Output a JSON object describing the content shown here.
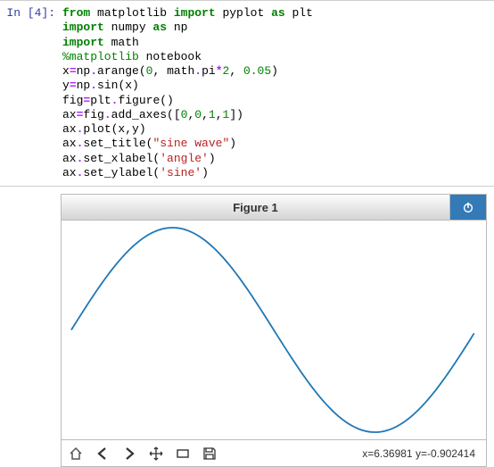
{
  "cell": {
    "prompt": "In [4]:",
    "code": {
      "l1a": "from",
      "l1b": " matplotlib ",
      "l1c": "import",
      "l1d": " pyplot ",
      "l1e": "as",
      "l1f": " plt",
      "l2a": "import",
      "l2b": " numpy ",
      "l2c": "as",
      "l2d": " np",
      "l3a": "import",
      "l3b": " math",
      "l4": "%matplotlib",
      "l4b": " notebook",
      "l5a": "x",
      "l5b": "=",
      "l5c": "np",
      "l5d": ".",
      "l5e": "arange(",
      "l5f": "0",
      "l5g": ", math",
      "l5h": ".",
      "l5i": "pi",
      "l5j": "*",
      "l5k": "2",
      "l5l": ", ",
      "l5m": "0.05",
      "l5n": ")",
      "l6a": "y",
      "l6b": "=",
      "l6c": "np",
      "l6d": ".",
      "l6e": "sin(x)",
      "l7a": "fig",
      "l7b": "=",
      "l7c": "plt",
      "l7d": ".",
      "l7e": "figure()",
      "l8a": "ax",
      "l8b": "=",
      "l8c": "fig",
      "l8d": ".",
      "l8e": "add_axes([",
      "l8f": "0",
      "l8g": ",",
      "l8h": "0",
      "l8i": ",",
      "l8j": "1",
      "l8k": ",",
      "l8l": "1",
      "l8m": "])",
      "l9a": "ax",
      "l9b": ".",
      "l9c": "plot(x,y)",
      "l10a": "ax",
      "l10b": ".",
      "l10c": "set_title(",
      "l10d": "\"sine wave\"",
      "l10e": ")",
      "l11a": "ax",
      "l11b": ".",
      "l11c": "set_xlabel(",
      "l11d": "'angle'",
      "l11e": ")",
      "l12a": "ax",
      "l12b": ".",
      "l12c": "set_ylabel(",
      "l12d": "'sine'",
      "l12e": ")"
    }
  },
  "figure": {
    "title": "Figure 1",
    "coords": "x=6.36981 y=-0.902414"
  },
  "toolbar": {
    "home": "⌂",
    "back": "←",
    "forward": "→",
    "pan": "✥",
    "zoom": "▭",
    "save": "💾"
  },
  "chart_data": {
    "type": "line",
    "title": "sine wave",
    "xlabel": "angle",
    "ylabel": "sine",
    "xlim": [
      0,
      6.283
    ],
    "ylim": [
      -1,
      1
    ],
    "series": [
      {
        "name": "sin(x)",
        "color": "#1f77b4",
        "function": "sin",
        "x_start": 0,
        "x_end": 6.283,
        "x_step": 0.05
      }
    ]
  }
}
